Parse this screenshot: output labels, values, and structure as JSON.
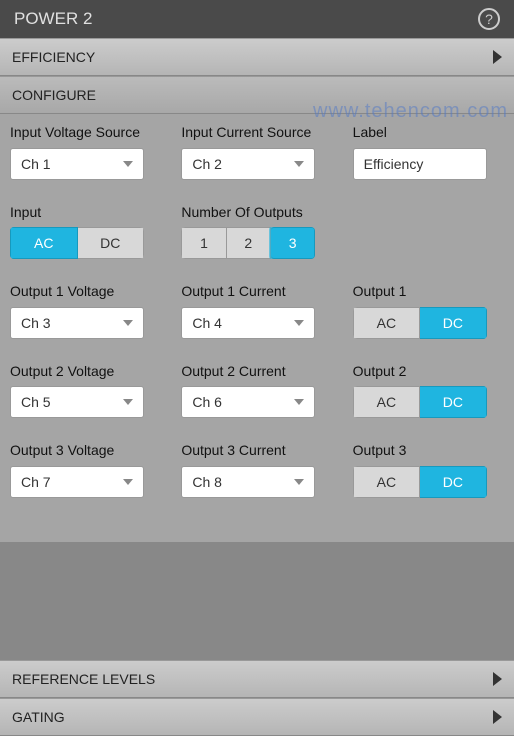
{
  "header": {
    "title": "POWER 2"
  },
  "watermark": "www.tehencom.com",
  "sections": {
    "efficiency": "EFFICIENCY",
    "configure": "CONFIGURE",
    "reference_levels": "REFERENCE LEVELS",
    "gating": "GATING"
  },
  "configure": {
    "input_voltage_source": {
      "label": "Input Voltage Source",
      "value": "Ch 1"
    },
    "input_current_source": {
      "label": "Input Current Source",
      "value": "Ch 2"
    },
    "label_field": {
      "label": "Label",
      "value": "Efficiency"
    },
    "input_mode": {
      "label": "Input",
      "options": [
        "AC",
        "DC"
      ],
      "selected": "AC"
    },
    "num_outputs": {
      "label": "Number Of Outputs",
      "options": [
        "1",
        "2",
        "3"
      ],
      "selected": "3"
    },
    "out1_voltage": {
      "label": "Output 1 Voltage",
      "value": "Ch 3"
    },
    "out1_current": {
      "label": "Output 1 Current",
      "value": "Ch 4"
    },
    "out1_mode": {
      "label": "Output 1",
      "options": [
        "AC",
        "DC"
      ],
      "selected": "DC"
    },
    "out2_voltage": {
      "label": "Output 2 Voltage",
      "value": "Ch 5"
    },
    "out2_current": {
      "label": "Output 2 Current",
      "value": "Ch 6"
    },
    "out2_mode": {
      "label": "Output 2",
      "options": [
        "AC",
        "DC"
      ],
      "selected": "DC"
    },
    "out3_voltage": {
      "label": "Output 3 Voltage",
      "value": "Ch 7"
    },
    "out3_current": {
      "label": "Output 3 Current",
      "value": "Ch 8"
    },
    "out3_mode": {
      "label": "Output 3",
      "options": [
        "AC",
        "DC"
      ],
      "selected": "DC"
    }
  }
}
